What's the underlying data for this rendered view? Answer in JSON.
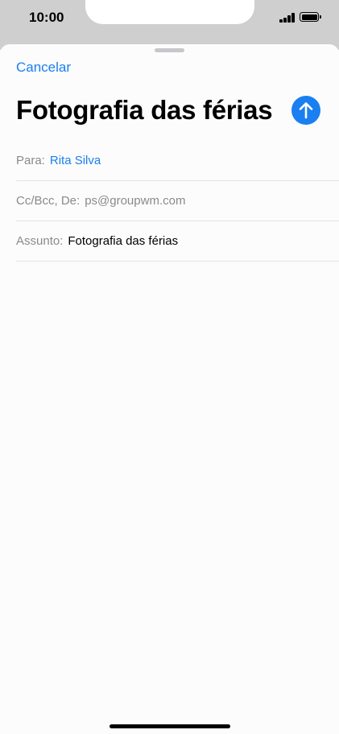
{
  "status_bar": {
    "time": "10:00",
    "signal_icon": "cellular-signal-icon",
    "battery_icon": "battery-icon"
  },
  "header": {
    "cancel_label": "Cancelar",
    "title": "Fotografia das férias",
    "send_icon": "arrow-up-icon",
    "accent_color": "#1a7ff0"
  },
  "fields": {
    "to": {
      "label": "Para:",
      "value": "Rita Silva"
    },
    "cc_from": {
      "label": "Cc/Bcc, De:",
      "value": "ps@groupwm.com"
    },
    "subject": {
      "label": "Assunto:",
      "value": "Fotografia das férias"
    }
  },
  "body": {
    "text": ""
  }
}
